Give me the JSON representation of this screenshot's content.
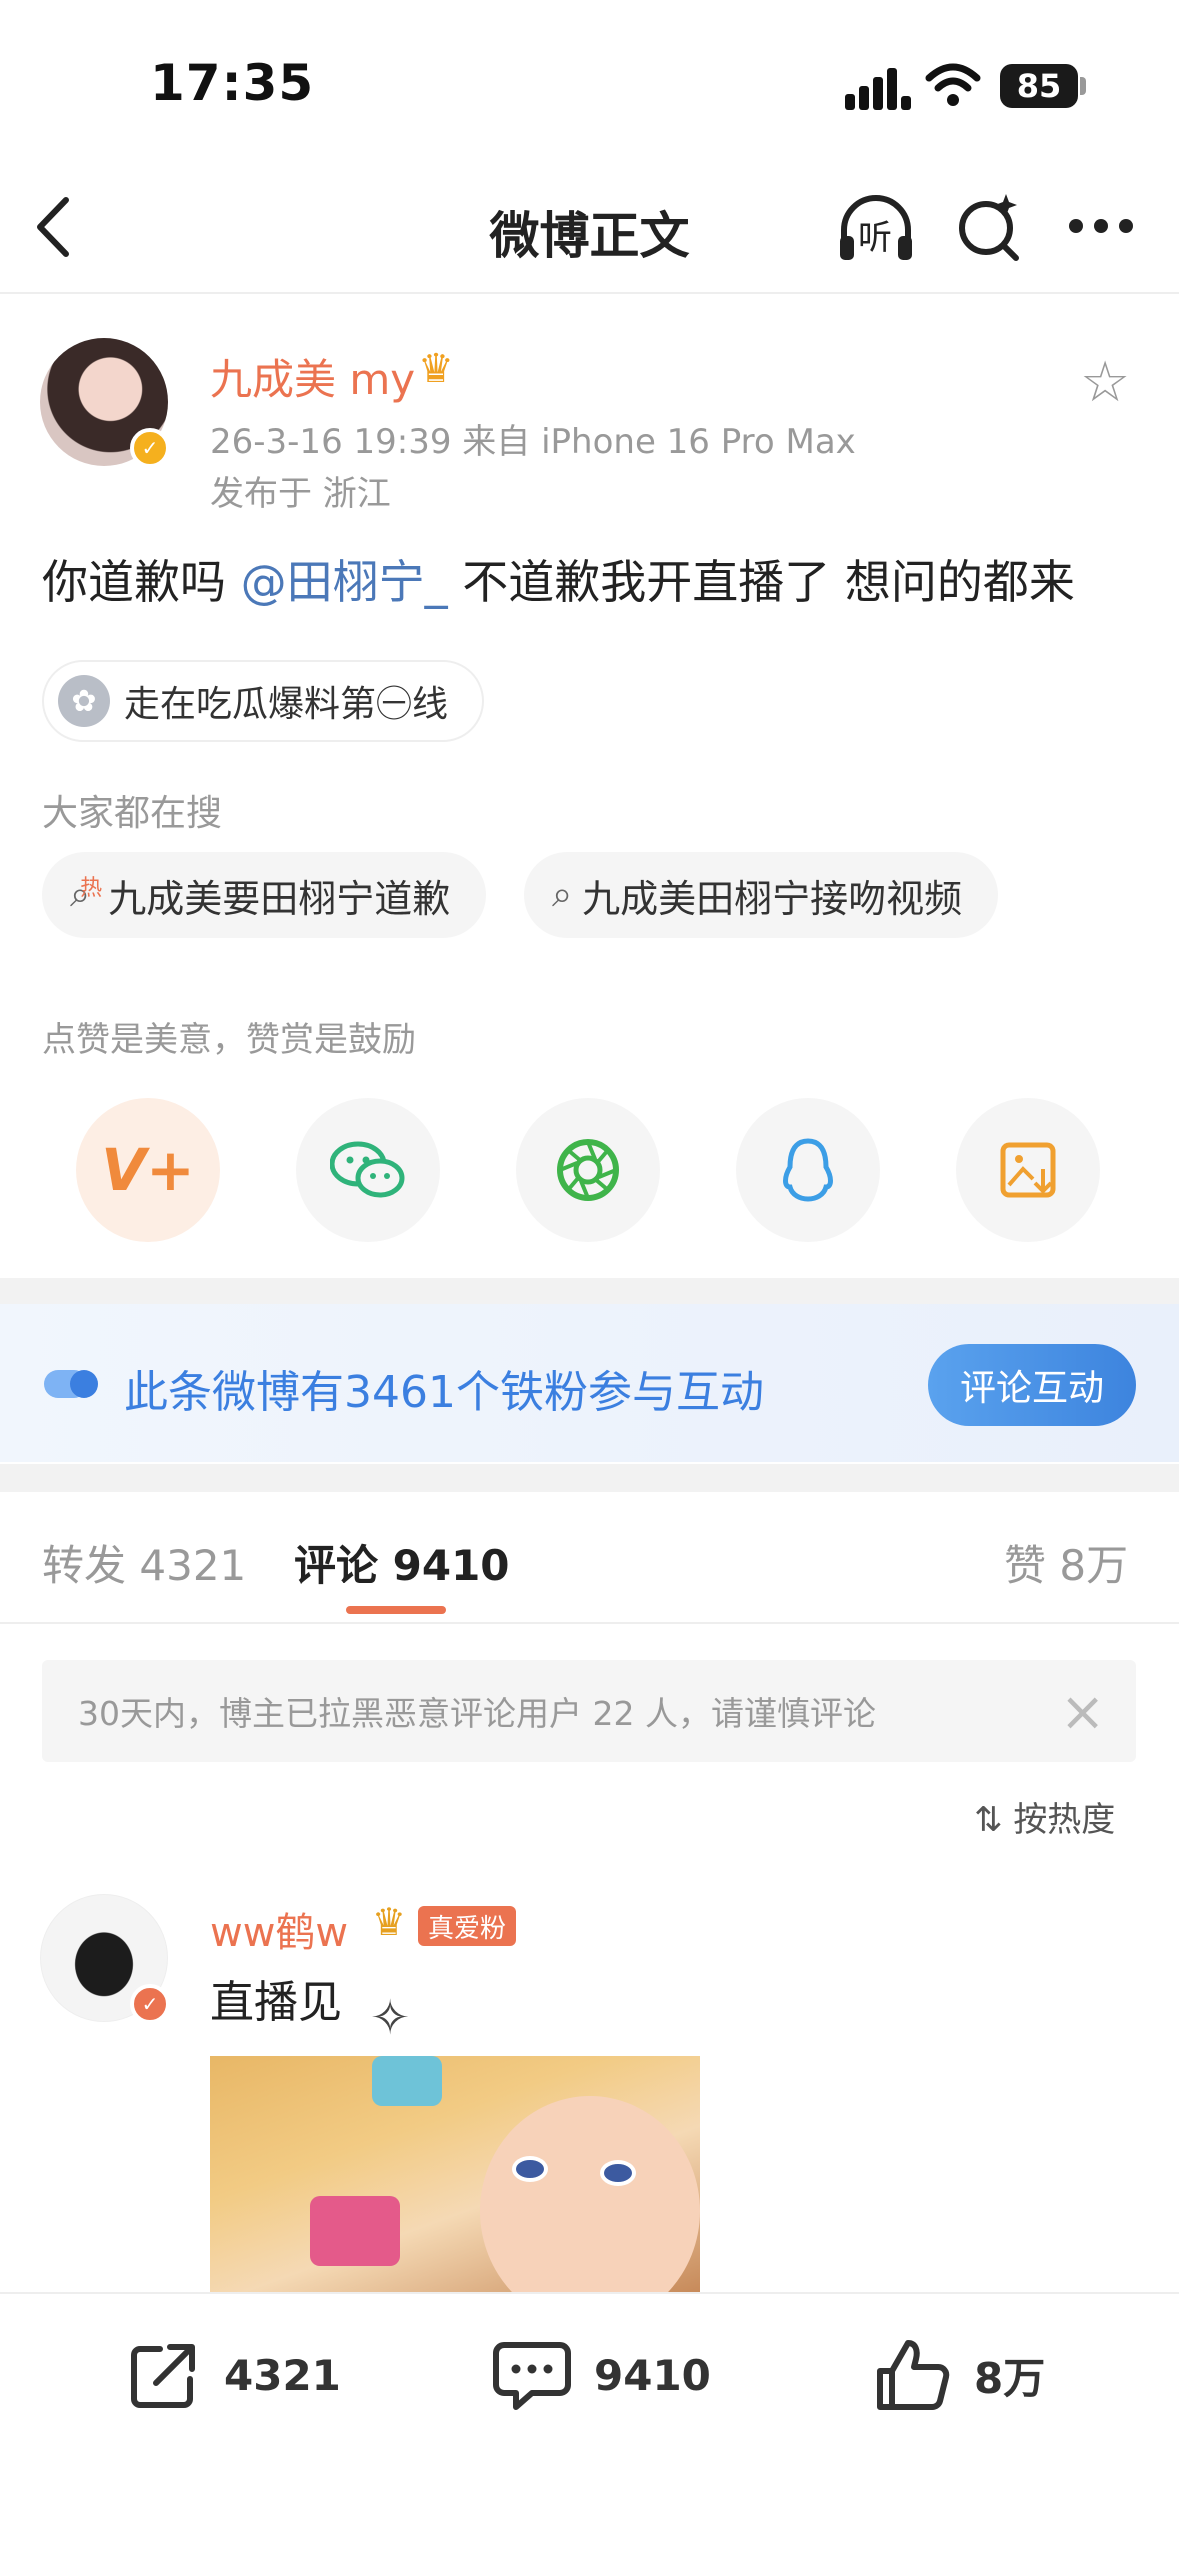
{
  "status_bar": {
    "time": "17:35",
    "battery": "85"
  },
  "nav": {
    "title": "微博正文",
    "listen_label": "听"
  },
  "post": {
    "author": "九成美 my",
    "time_source": "26-3-16 19:39  来自 iPhone 16 Pro Max",
    "location": "发布于 浙江",
    "text_before": "你道歉吗 ",
    "mention": "@田栩宁_",
    "text_after": " 不道歉我开直播了 想问的都来",
    "topic": "走在吃瓜爆料第㊀线",
    "search_heading": "大家都在搜",
    "searches": [
      "九成美要田栩宁道歉",
      "九成美田栩宁接吻视频"
    ],
    "hot_tag": "热",
    "reward_text": "点赞是美意，赞赏是鼓励"
  },
  "fan_banner": {
    "text": "此条微博有3461个铁粉参与互动",
    "button": "评论互动"
  },
  "tabs": {
    "repost_label": "转发",
    "repost_count": "4321",
    "comment_label": "评论",
    "comment_count": "9410",
    "like_label": "赞",
    "like_count": "8万"
  },
  "notice": {
    "text": "30天内，博主已拉黑恶意评论用户 22 人，请谨慎评论"
  },
  "sort": {
    "label": "按热度"
  },
  "comment": {
    "author": "ww鹤w",
    "badge": "真爱粉",
    "text": "直播见"
  },
  "bottom_bar": {
    "repost": "4321",
    "comment": "9410",
    "like": "8万"
  },
  "colors": {
    "accent": "#eb7350",
    "link": "#4b78b8",
    "blue": "#3b7fe0"
  },
  "icons": [
    "back-arrow-icon",
    "headphone-icon",
    "search-icon",
    "more-icon",
    "star-icon",
    "weibo-share-icon",
    "wechat-icon",
    "moments-icon",
    "qq-icon",
    "save-image-icon",
    "repost-icon",
    "comment-icon",
    "like-icon"
  ]
}
